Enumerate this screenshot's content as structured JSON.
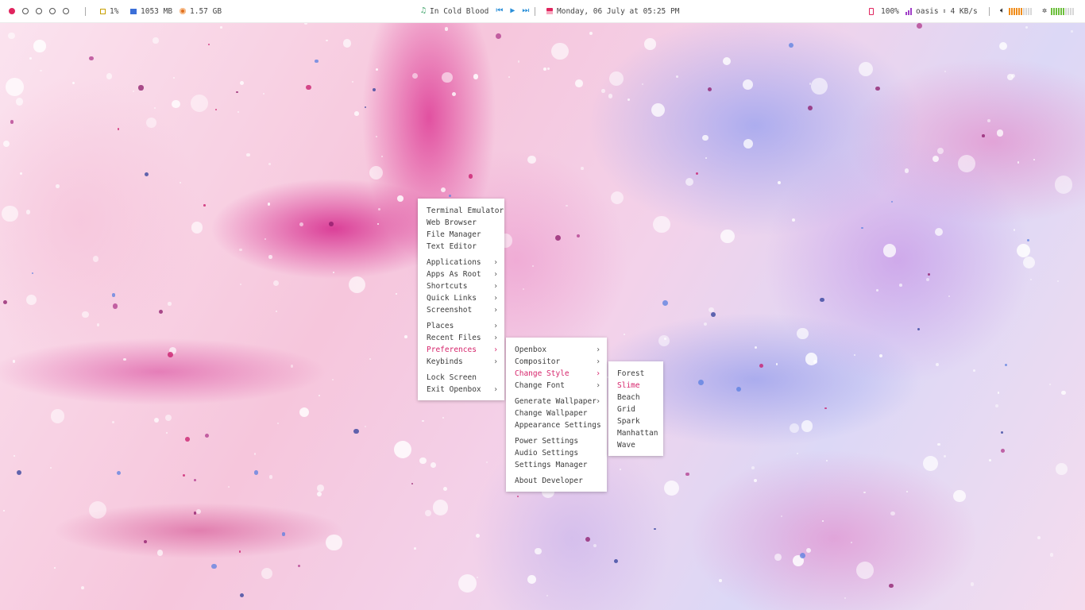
{
  "topbar": {
    "workspaces": [
      {
        "name": "workspace-1",
        "active": true
      },
      {
        "name": "workspace-2",
        "active": false
      },
      {
        "name": "workspace-3",
        "active": false
      },
      {
        "name": "workspace-4",
        "active": false
      },
      {
        "name": "workspace-5",
        "active": false
      }
    ],
    "cpu": {
      "icon": "cpu-icon",
      "value": "1%"
    },
    "memory": {
      "icon": "memory-icon",
      "value": "1053 MB"
    },
    "disk": {
      "icon": "disk-icon",
      "value": "1.57 GB"
    },
    "music": {
      "icon": "music-note-icon",
      "track": "In Cold Blood"
    },
    "date": {
      "icon": "calendar-icon",
      "text": "Monday, 06 July at 05:25 PM"
    },
    "battery": {
      "icon": "battery-charging-icon",
      "value": "100%"
    },
    "network": {
      "icon": "wifi-signal-icon",
      "ssid": "oasis",
      "speed": "4 KB/s"
    },
    "volume": {
      "icon": "volume-icon",
      "level": 0.6
    },
    "brightness": {
      "icon": "brightness-icon",
      "level": 0.6
    }
  },
  "colors": {
    "accent": "#d6246b",
    "active_workspace": "#e0245e",
    "cpu": "#c8a000",
    "memory": "#3b6fd8",
    "disk": "#e07020",
    "music": "#2a9a5a",
    "calendar": "#e0245e",
    "battery": "#e0245e",
    "network": "#a03ec8",
    "volume": "#f08c1a",
    "brightness": "#6cbf3c"
  },
  "menus": {
    "main": {
      "groups": [
        [
          {
            "label": "Terminal Emulator"
          },
          {
            "label": "Web Browser"
          },
          {
            "label": "File Manager"
          },
          {
            "label": "Text Editor"
          }
        ],
        [
          {
            "label": "Applications",
            "submenu": true
          },
          {
            "label": "Apps As Root",
            "submenu": true
          },
          {
            "label": "Shortcuts",
            "submenu": true
          },
          {
            "label": "Quick Links",
            "submenu": true
          },
          {
            "label": "Screenshot",
            "submenu": true
          }
        ],
        [
          {
            "label": "Places",
            "submenu": true
          },
          {
            "label": "Recent Files",
            "submenu": true
          },
          {
            "label": "Preferences",
            "submenu": true,
            "active": true
          },
          {
            "label": "Keybinds",
            "submenu": true
          }
        ],
        [
          {
            "label": "Lock Screen"
          },
          {
            "label": "Exit Openbox",
            "submenu": true
          }
        ]
      ]
    },
    "preferences": {
      "groups": [
        [
          {
            "label": "Openbox",
            "submenu": true
          },
          {
            "label": "Compositor",
            "submenu": true
          },
          {
            "label": "Change Style",
            "submenu": true,
            "active": true
          },
          {
            "label": "Change Font",
            "submenu": true
          }
        ],
        [
          {
            "label": "Generate Wallpaper",
            "submenu": true
          },
          {
            "label": "Change Wallpaper"
          },
          {
            "label": "Appearance Settings"
          }
        ],
        [
          {
            "label": "Power Settings"
          },
          {
            "label": "Audio Settings"
          },
          {
            "label": "Settings Manager"
          }
        ],
        [
          {
            "label": "About Developer"
          }
        ]
      ]
    },
    "styles": {
      "groups": [
        [
          {
            "label": "Forest"
          },
          {
            "label": "Slime",
            "active": true
          },
          {
            "label": "Beach"
          },
          {
            "label": "Grid"
          },
          {
            "label": "Spark"
          },
          {
            "label": "Manhattan"
          },
          {
            "label": "Wave"
          }
        ]
      ]
    },
    "arrow_glyph": "›"
  }
}
